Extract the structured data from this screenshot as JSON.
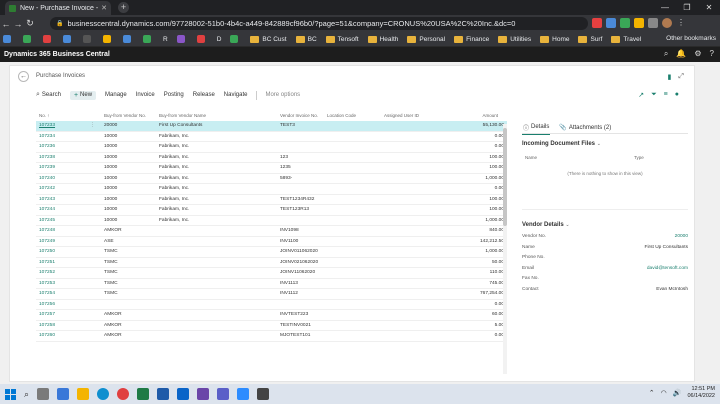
{
  "browser": {
    "tab_title": "New - Purchase Invoice - Dynam",
    "url": "businesscentral.dynamics.com/97728002-51b0-4b4c-a449-842889cf96b0/?page=51&company=CRONUS%20USA%2C%20Inc.&dc=0",
    "bookmarks": [
      {
        "label": "R",
        "icon": "r-icon",
        "color": "#e04040"
      },
      {
        "label": "D",
        "icon": "d-icon",
        "color": "#3a78d8"
      },
      {
        "label": "BC Cust",
        "icon": "folder-icon"
      },
      {
        "label": "BC",
        "icon": "folder-icon"
      },
      {
        "label": "Tensoft",
        "icon": "folder-icon"
      },
      {
        "label": "Health",
        "icon": "folder-icon"
      },
      {
        "label": "Personal",
        "icon": "folder-icon"
      },
      {
        "label": "Finance",
        "icon": "folder-icon"
      },
      {
        "label": "Utilities",
        "icon": "folder-icon"
      },
      {
        "label": "Home",
        "icon": "folder-icon"
      },
      {
        "label": "Surf",
        "icon": "folder-icon"
      },
      {
        "label": "Travel",
        "icon": "folder-icon"
      }
    ],
    "other_bookmarks": "Other bookmarks"
  },
  "app": {
    "title": "Dynamics 365 Business Central"
  },
  "page": {
    "title": "Purchase Invoices",
    "actions": {
      "search": "Search",
      "new": "New",
      "manage": "Manage",
      "invoice": "Invoice",
      "posting": "Posting",
      "release": "Release",
      "navigate": "Navigate",
      "more": "More options"
    }
  },
  "table": {
    "headers": {
      "no": "No. ↑",
      "buy_from_vendor_no": "Buy-from Vendor No.",
      "buy_from_vendor_name": "Buy-from Vendor Name",
      "vendor_invoice_no": "Vendor Invoice No.",
      "location_code": "Location Code",
      "assigned_user_id": "Assigned User ID",
      "amount": "Amount"
    },
    "rows": [
      {
        "no": "107233",
        "vendor_no": "20000",
        "vendor_name": "First Up Consultants",
        "vendor_inv": "TEST3",
        "amount": "55,130.00",
        "selected": true
      },
      {
        "no": "107234",
        "vendor_no": "10000",
        "vendor_name": "Fabrikam, Inc.",
        "vendor_inv": "",
        "amount": "0.00"
      },
      {
        "no": "107236",
        "vendor_no": "10000",
        "vendor_name": "Fabrikam, Inc.",
        "vendor_inv": "",
        "amount": "0.00"
      },
      {
        "no": "107238",
        "vendor_no": "10000",
        "vendor_name": "Fabrikam, Inc.",
        "vendor_inv": "123",
        "amount": "100.00"
      },
      {
        "no": "107239",
        "vendor_no": "10000",
        "vendor_name": "Fabrikam, Inc.",
        "vendor_inv": "1235",
        "amount": "100.00"
      },
      {
        "no": "107240",
        "vendor_no": "10000",
        "vendor_name": "Fabrikam, Inc.",
        "vendor_inv": "5893-",
        "amount": "1,000.00"
      },
      {
        "no": "107242",
        "vendor_no": "10000",
        "vendor_name": "Fabrikam, Inc.",
        "vendor_inv": "",
        "amount": "0.00"
      },
      {
        "no": "107243",
        "vendor_no": "10000",
        "vendor_name": "Fabrikam, Inc.",
        "vendor_inv": "TEST1234R432",
        "amount": "100.00"
      },
      {
        "no": "107244",
        "vendor_no": "10000",
        "vendor_name": "Fabrikam, Inc.",
        "vendor_inv": "TEST123R13",
        "amount": "100.00"
      },
      {
        "no": "107245",
        "vendor_no": "10000",
        "vendor_name": "Fabrikam, Inc.",
        "vendor_inv": "",
        "amount": "1,000.00"
      },
      {
        "no": "107248",
        "vendor_no": "AMKOR",
        "vendor_name": "",
        "vendor_inv": "INV1098",
        "amount": "840.00"
      },
      {
        "no": "107249",
        "vendor_no": "ASE",
        "vendor_name": "",
        "vendor_inv": "INV1100",
        "amount": "142,212.50"
      },
      {
        "no": "107250",
        "vendor_no": "TSMC",
        "vendor_name": "",
        "vendor_inv": "JOINV011062020",
        "amount": "1,000.00"
      },
      {
        "no": "107251",
        "vendor_no": "TSMC",
        "vendor_name": "",
        "vendor_inv": "JOINV021062020",
        "amount": "50.00"
      },
      {
        "no": "107252",
        "vendor_no": "TSMC",
        "vendor_name": "",
        "vendor_inv": "JOINV11062020",
        "amount": "110.00"
      },
      {
        "no": "107253",
        "vendor_no": "TSMC",
        "vendor_name": "",
        "vendor_inv": "INV1113",
        "amount": "745.00"
      },
      {
        "no": "107254",
        "vendor_no": "TSMC",
        "vendor_name": "",
        "vendor_inv": "INV1112",
        "amount": "767,254.00"
      },
      {
        "no": "107256",
        "vendor_no": "",
        "vendor_name": "",
        "vendor_inv": "",
        "amount": "0.00"
      },
      {
        "no": "107257",
        "vendor_no": "AMKOR",
        "vendor_name": "",
        "vendor_inv": "INVTEST223",
        "amount": "60.00"
      },
      {
        "no": "107258",
        "vendor_no": "AMKOR",
        "vendor_name": "",
        "vendor_inv": "TESTINV0021",
        "amount": "5.00"
      },
      {
        "no": "107260",
        "vendor_no": "AMKOR",
        "vendor_name": "",
        "vendor_inv": "MJOTEST101",
        "amount": "0.00"
      }
    ]
  },
  "factbox": {
    "tabs": {
      "details": "Details",
      "attachments": "Attachments (2)"
    },
    "incoming_title": "Incoming Document Files",
    "incoming_cols": {
      "name": "Name",
      "type": "Type"
    },
    "incoming_empty": "(There is nothing to show in this view)",
    "vendor_title": "Vendor Details",
    "vendor_fields": [
      {
        "label": "Vendor No.",
        "value": "20000",
        "link": true
      },
      {
        "label": "Name",
        "value": "First Up Consultants"
      },
      {
        "label": "Phone No.",
        "value": ""
      },
      {
        "label": "Email",
        "value": "david@tensoft.com",
        "link": true
      },
      {
        "label": "Fax No.",
        "value": ""
      },
      {
        "label": "Contact",
        "value": "Evan McIntosh"
      }
    ]
  },
  "taskbar": {
    "time": "12:51 PM",
    "date": "06/14/2022"
  }
}
